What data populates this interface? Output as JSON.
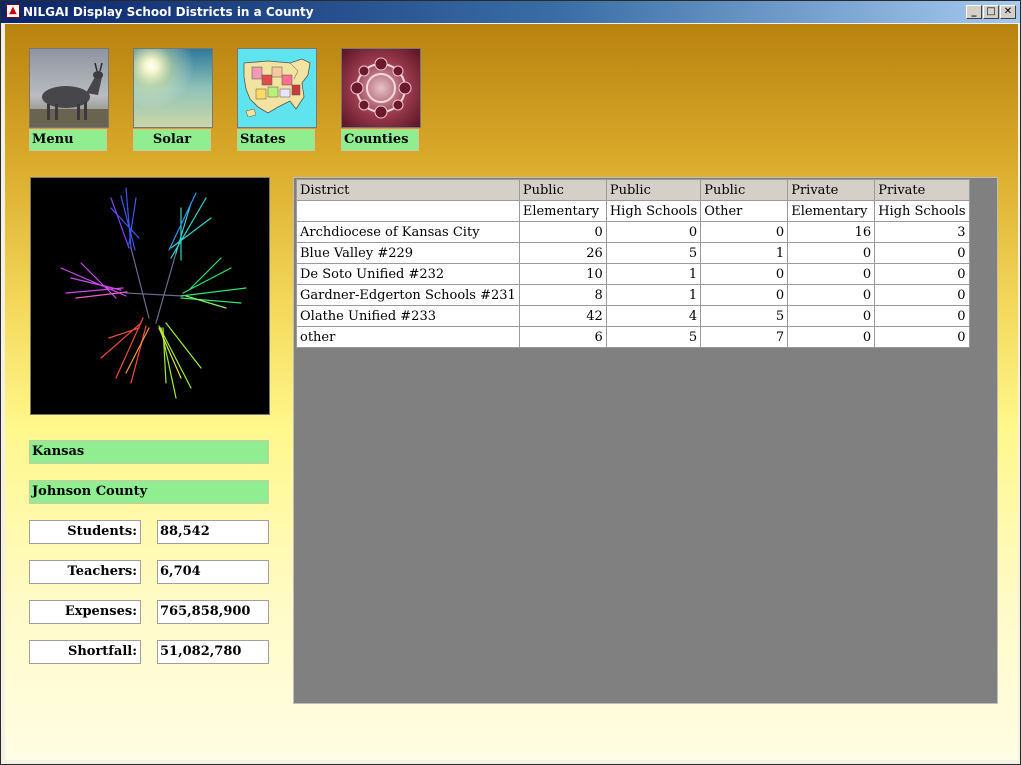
{
  "window": {
    "title": "NILGAI Display School Districts in a County"
  },
  "nav": [
    {
      "id": "menu",
      "label": "Menu",
      "align": "left"
    },
    {
      "id": "solar",
      "label": "Solar",
      "align": "center"
    },
    {
      "id": "states",
      "label": "States",
      "align": "left"
    },
    {
      "id": "counties",
      "label": "Counties",
      "align": "left"
    }
  ],
  "location": {
    "state": "Kansas",
    "county": "Johnson County"
  },
  "stats": {
    "students_label": "Students:",
    "students": "88,542",
    "teachers_label": "Teachers:",
    "teachers": "6,704",
    "expenses_label": "Expenses:",
    "expenses": "765,858,900",
    "shortfall_label": "Shortfall:",
    "shortfall": "51,082,780"
  },
  "table": {
    "header1": [
      "District",
      "Public",
      "Public",
      "Public",
      "Private",
      "Private"
    ],
    "header2": [
      "",
      "Elementary",
      "High Schools",
      "Other",
      "Elementary",
      "High Schools"
    ],
    "rows": [
      [
        "Archdiocese of Kansas City",
        "0",
        "0",
        "0",
        "16",
        "3"
      ],
      [
        "Blue Valley #229",
        "26",
        "5",
        "1",
        "0",
        "0"
      ],
      [
        "De Soto Unified #232",
        "10",
        "1",
        "0",
        "0",
        "0"
      ],
      [
        "Gardner-Edgerton Schools #231",
        "8",
        "1",
        "0",
        "0",
        "0"
      ],
      [
        "Olathe Unified #233",
        "42",
        "4",
        "5",
        "0",
        "0"
      ],
      [
        "other",
        "6",
        "5",
        "7",
        "0",
        "0"
      ]
    ]
  },
  "colors": {
    "label_green": "#90ee90",
    "panel_gray": "#808080",
    "header_gray": "#d4d0c8"
  },
  "icons": [
    "app-icon",
    "minimize-icon",
    "maximize-icon",
    "close-icon"
  ]
}
